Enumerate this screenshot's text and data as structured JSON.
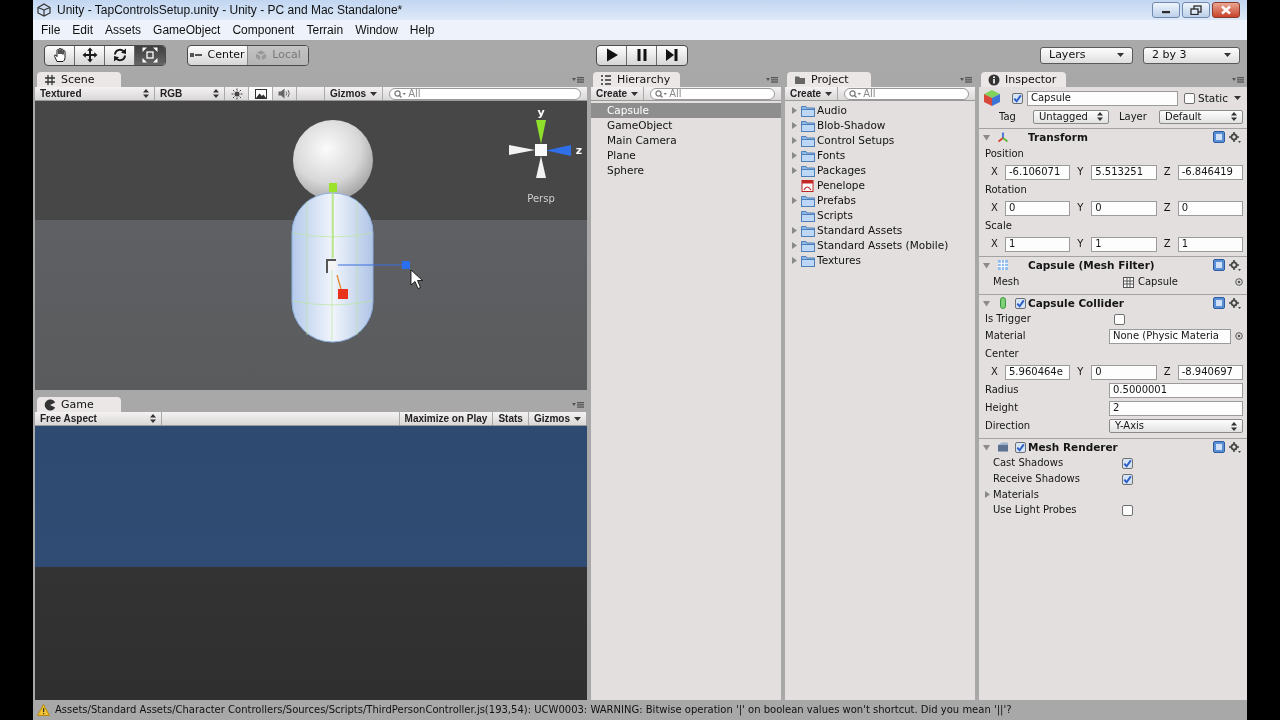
{
  "window": {
    "title": "Unity - TapControlsSetup.unity - Unity - PC and Mac Standalone*",
    "controls": [
      {
        "kind": "minimize"
      },
      {
        "kind": "restore"
      },
      {
        "kind": "close"
      }
    ]
  },
  "menu": [
    "File",
    "Edit",
    "Assets",
    "GameObject",
    "Component",
    "Terrain",
    "Window",
    "Help"
  ],
  "toolbar": {
    "tools": [
      {
        "kind": "hand",
        "selected": false
      },
      {
        "kind": "move",
        "selected": false
      },
      {
        "kind": "rotate",
        "selected": false
      },
      {
        "kind": "scale",
        "selected": true
      }
    ],
    "pivot": [
      {
        "kind": "center",
        "label": "Center",
        "disabled": false
      },
      {
        "kind": "local",
        "label": "Local",
        "disabled": true
      }
    ],
    "playback": [
      {
        "kind": "play"
      },
      {
        "kind": "pause"
      },
      {
        "kind": "step"
      }
    ],
    "layers": "Layers",
    "layout": "2 by 3"
  },
  "scene": {
    "tab": {
      "kind": "scene",
      "label": "Scene"
    },
    "toolbar": {
      "draw_mode": "Textured",
      "color_mode": "RGB",
      "toggles": [
        {
          "kind": "lighting",
          "on": false
        },
        {
          "kind": "skybox",
          "on": true
        },
        {
          "kind": "audio",
          "on": false
        }
      ],
      "gizmos": "Gizmos",
      "search": {
        "placeholder": "All"
      }
    },
    "view": {
      "axis_labels": [
        "y",
        "z"
      ],
      "projection": "Persp"
    }
  },
  "game": {
    "tab": {
      "kind": "game",
      "label": "Game"
    },
    "aspect": "Free Aspect",
    "buttons": [
      {
        "kind": "toggle",
        "label": "Maximize on Play"
      },
      {
        "kind": "toggle",
        "label": "Stats"
      },
      {
        "kind": "dropdown",
        "label": "Gizmos"
      }
    ]
  },
  "hierarchy": {
    "tab": {
      "kind": "hierarchy",
      "label": "Hierarchy"
    },
    "create": "Create",
    "search": {
      "placeholder": "All"
    },
    "items": [
      {
        "label": "Capsule",
        "selected": true
      },
      {
        "label": "GameObject",
        "selected": false
      },
      {
        "label": "Main Camera",
        "selected": false
      },
      {
        "label": "Plane",
        "selected": false
      },
      {
        "label": "Sphere",
        "selected": false
      }
    ]
  },
  "project": {
    "tab": {
      "kind": "project",
      "label": "Project"
    },
    "create": "Create",
    "search": {
      "placeholder": "All"
    },
    "items": [
      {
        "kind": "folder",
        "label": "Audio",
        "expandable": true
      },
      {
        "kind": "folder",
        "label": "Blob-Shadow",
        "expandable": true
      },
      {
        "kind": "folder",
        "label": "Control Setups",
        "expandable": true
      },
      {
        "kind": "folder",
        "label": "Fonts",
        "expandable": true
      },
      {
        "kind": "folder",
        "label": "Packages",
        "expandable": true
      },
      {
        "kind": "document",
        "label": "Penelope",
        "expandable": false
      },
      {
        "kind": "folder",
        "label": "Prefabs",
        "expandable": true
      },
      {
        "kind": "folder",
        "label": "Scripts",
        "expandable": false
      },
      {
        "kind": "folder",
        "label": "Standard Assets",
        "expandable": true
      },
      {
        "kind": "folder",
        "label": "Standard Assets (Mobile)",
        "expandable": true
      },
      {
        "kind": "folder",
        "label": "Textures",
        "expandable": true
      }
    ]
  },
  "inspector": {
    "tab": {
      "kind": "inspector",
      "label": "Inspector"
    },
    "object": {
      "active": true,
      "name": "Capsule",
      "static_label": "Static",
      "static": false,
      "tag_label": "Tag",
      "tag": "Untagged",
      "layer_label": "Layer",
      "layer": "Default"
    },
    "components": [
      {
        "kind": "transform",
        "title": "Transform",
        "expanded": true,
        "rows": [
          {
            "kind": "heading",
            "label": "Position"
          },
          {
            "kind": "vector",
            "values": [
              {
                "axis": "X",
                "value": "-6.106071"
              },
              {
                "axis": "Y",
                "value": "5.513251"
              },
              {
                "axis": "Z",
                "value": "-6.846419"
              }
            ]
          },
          {
            "kind": "heading",
            "label": "Rotation"
          },
          {
            "kind": "vector",
            "values": [
              {
                "axis": "X",
                "value": "0"
              },
              {
                "axis": "Y",
                "value": "0"
              },
              {
                "axis": "Z",
                "value": "0"
              }
            ]
          },
          {
            "kind": "heading",
            "label": "Scale"
          },
          {
            "kind": "vector",
            "values": [
              {
                "axis": "X",
                "value": "1"
              },
              {
                "axis": "Y",
                "value": "1"
              },
              {
                "axis": "Z",
                "value": "1"
              }
            ]
          }
        ]
      },
      {
        "kind": "mesh_filter",
        "title": "Capsule (Mesh Filter)",
        "expanded": true,
        "rows": [
          {
            "kind": "object",
            "label": "Mesh",
            "value": "Capsule"
          }
        ]
      },
      {
        "kind": "capsule_collider",
        "title": "Capsule Collider",
        "expanded": true,
        "enabled": true,
        "rows": [
          {
            "kind": "checkbox",
            "label": "Is Trigger",
            "checked": false
          },
          {
            "kind": "object_field",
            "label": "Material",
            "value": "None (Physic Materia"
          },
          {
            "kind": "heading",
            "label": "Center"
          },
          {
            "kind": "vector",
            "values": [
              {
                "axis": "X",
                "value": "5.960464e"
              },
              {
                "axis": "Y",
                "value": "0"
              },
              {
                "axis": "Z",
                "value": "-8.940697"
              }
            ]
          },
          {
            "kind": "text",
            "label": "Radius",
            "value": "0.5000001"
          },
          {
            "kind": "text",
            "label": "Height",
            "value": "2"
          },
          {
            "kind": "dropdown",
            "label": "Direction",
            "value": "Y-Axis"
          }
        ]
      },
      {
        "kind": "mesh_renderer",
        "title": "Mesh Renderer",
        "expanded": true,
        "enabled": true,
        "rows": [
          {
            "kind": "checkbox",
            "label": "Cast Shadows",
            "checked": true
          },
          {
            "kind": "checkbox",
            "label": "Receive Shadows",
            "checked": true
          },
          {
            "kind": "foldout",
            "label": "Materials",
            "expanded": false
          },
          {
            "kind": "checkbox",
            "label": "Use Light Probes",
            "checked": false
          }
        ]
      }
    ]
  },
  "status_bar": {
    "kind": "warning",
    "message": "Assets/Standard Assets/Character Controllers/Sources/Scripts/ThirdPersonController.js(193,54): UCW0003: WARNING: Bitwise operation '|' on boolean values won't shortcut. Did you mean '||'?"
  }
}
